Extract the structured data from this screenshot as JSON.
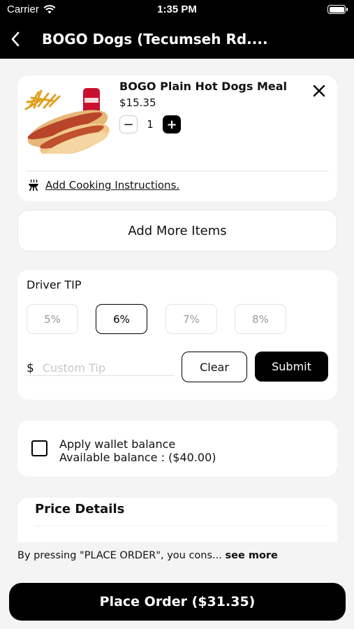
{
  "status": {
    "carrier": "Carrier",
    "time": "1:35 PM"
  },
  "header": {
    "title": "BOGO Dogs (Tecumseh Rd...."
  },
  "cart_item": {
    "name": "BOGO Plain Hot Dogs Meal",
    "price": "$15.35",
    "minus": "−",
    "quantity": "1",
    "plus": "+",
    "cooking_link": "Add Cooking Instructions."
  },
  "add_more": "Add More Items",
  "tip": {
    "title": "Driver TIP",
    "options": [
      "5%",
      "6%",
      "7%",
      "8%"
    ],
    "selected": "6%",
    "currency": "$",
    "custom_placeholder": "Custom Tip",
    "clear_label": "Clear",
    "submit_label": "Submit"
  },
  "wallet": {
    "apply_label": "Apply wallet balance",
    "available_label": "Available balance : ($40.00)",
    "checked": false
  },
  "price_details": {
    "title": "Price Details"
  },
  "footer": {
    "terms_text": "By pressing \"PLACE ORDER\", you cons...",
    "see_more": "see more",
    "place_order_label": "Place Order ($31.35)"
  }
}
